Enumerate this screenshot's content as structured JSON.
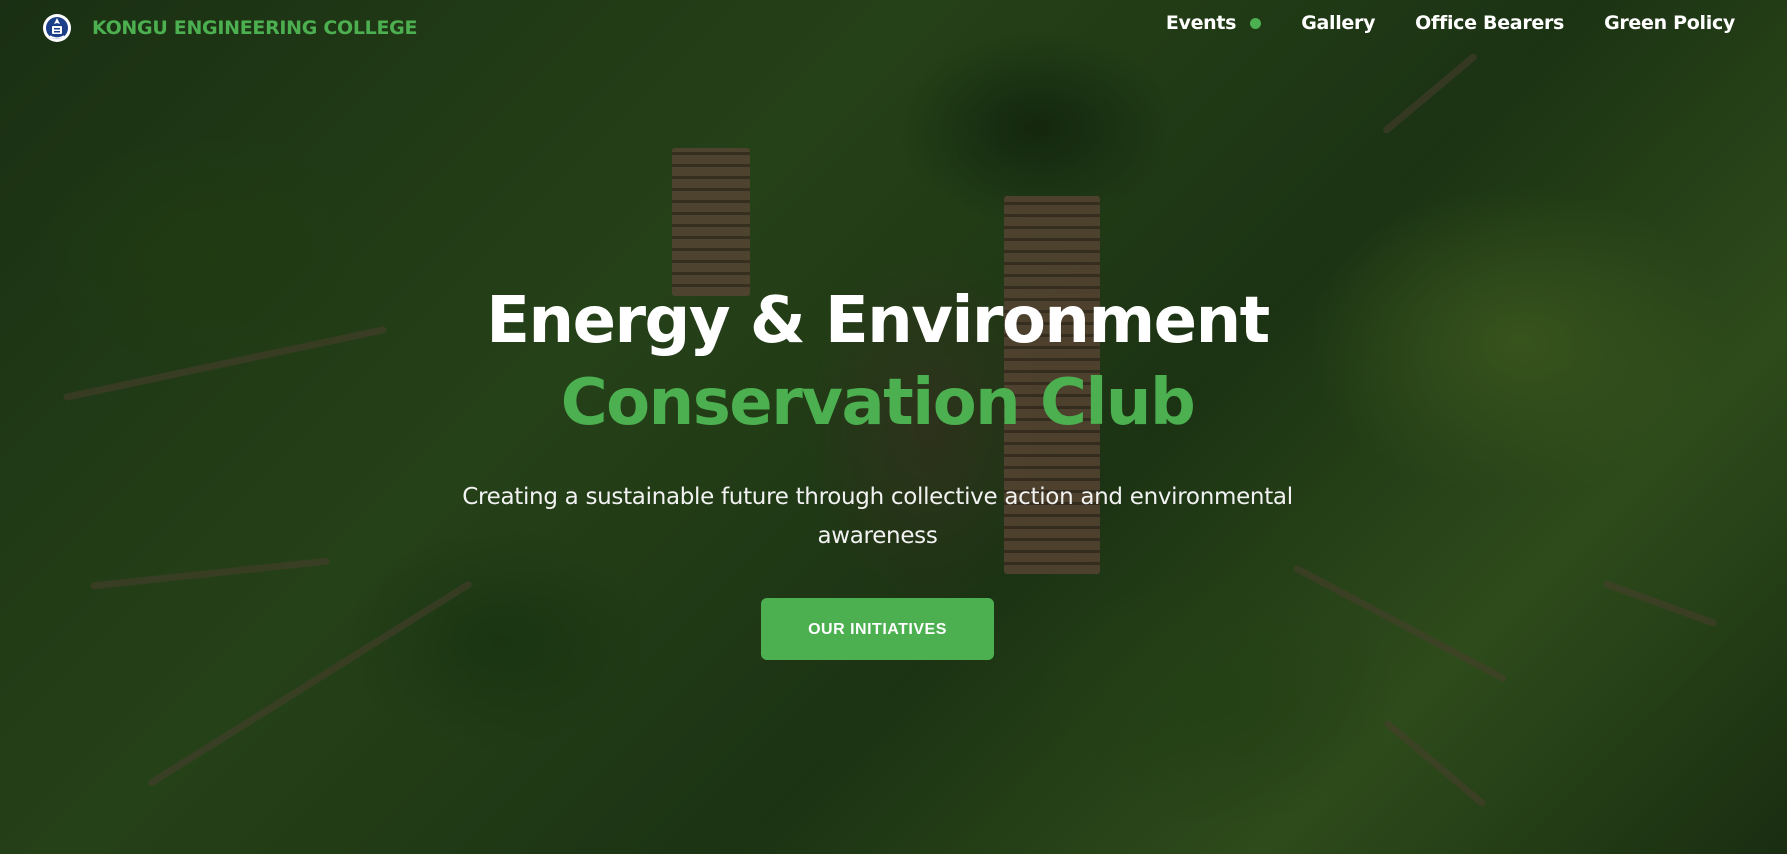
{
  "header": {
    "brand_name": "KONGU ENGINEERING COLLEGE",
    "logo_icon": "college-emblem-icon",
    "nav_items": [
      {
        "label": "Events",
        "indicator": true
      },
      {
        "label": "Gallery"
      },
      {
        "label": "Office Bearers"
      },
      {
        "label": "Green Policy"
      }
    ]
  },
  "hero": {
    "title_line1": "Energy & Environment",
    "title_line2": "Conservation Club",
    "subtitle": "Creating a sustainable future through collective action and environmental awareness",
    "cta_label": "OUR INITIATIVES",
    "background": "aerial-forest-image"
  },
  "colors": {
    "accent": "#4caf50",
    "text_primary": "#ffffff"
  }
}
